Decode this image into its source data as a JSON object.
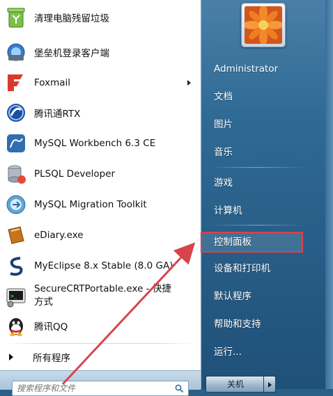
{
  "programs": [
    {
      "label": "清理电脑残留垃圾",
      "icon": "recycle-bin-icon"
    },
    {
      "label": "堡垒机登录客户端",
      "icon": "fortress-client-icon"
    },
    {
      "label": "Foxmail",
      "icon": "foxmail-icon",
      "has_submenu": true
    },
    {
      "label": "腾讯通RTX",
      "icon": "rtx-icon"
    },
    {
      "label": "MySQL Workbench 6.3 CE",
      "icon": "mysql-workbench-icon"
    },
    {
      "label": "PLSQL Developer",
      "icon": "plsql-developer-icon"
    },
    {
      "label": "MySQL Migration Toolkit",
      "icon": "mysql-migration-icon"
    },
    {
      "label": "eDiary.exe",
      "icon": "ediary-icon"
    },
    {
      "label": "MyEclipse 8.x Stable (8.0 GA)",
      "icon": "myeclipse-icon"
    },
    {
      "label": "SecureCRTPortable.exe - 快捷方式",
      "icon": "securecrt-icon"
    },
    {
      "label": "腾讯QQ",
      "icon": "qq-icon"
    }
  ],
  "all_programs_label": "所有程序",
  "search": {
    "placeholder": "搜索程序和文件"
  },
  "right_menu": [
    "Administrator",
    "文档",
    "图片",
    "音乐",
    "游戏",
    "计算机",
    "控制面板",
    "设备和打印机",
    "默认程序",
    "帮助和支持",
    "运行..."
  ],
  "highlighted_item": "控制面板",
  "shutdown_label": "关机",
  "colors": {
    "highlight_box": "#d8434d",
    "annotation_arrow": "#d8434d"
  }
}
